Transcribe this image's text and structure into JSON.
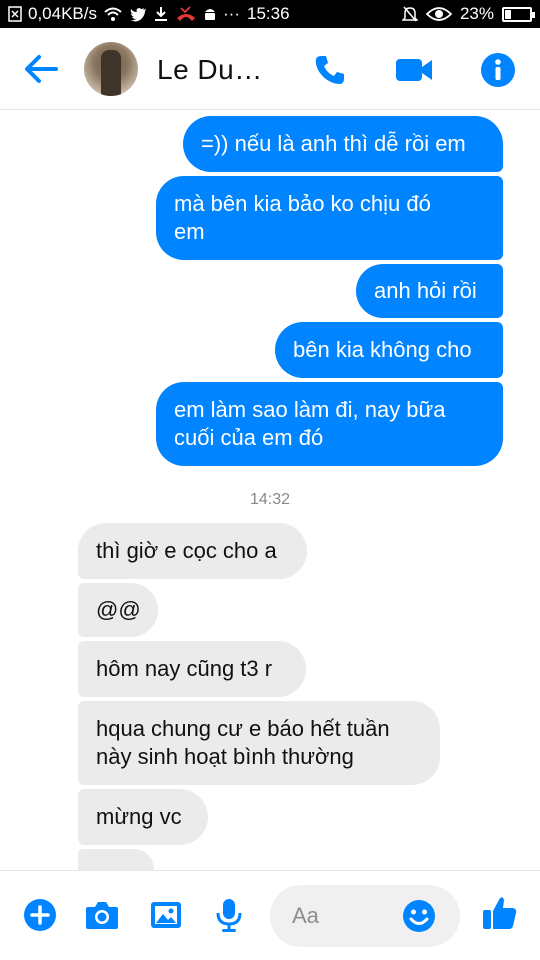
{
  "status_bar": {
    "speed": "0,04KB/s",
    "time": "15:36",
    "battery": "23%",
    "battery_level": 0.23
  },
  "header": {
    "contact_name": "Le Du…"
  },
  "messages": {
    "m1": "=)) nếu là anh thì dễ rồi em",
    "m2_line1": "mà bên kia bảo ko chịu đó",
    "m2_line2": "em",
    "m3": "anh hỏi rồi",
    "m4": "bên kia không cho",
    "m5_line1": "em làm sao làm đi, nay bữa",
    "m5_line2": "cuối của em đó",
    "timestamp": "14:32",
    "m6": "thì giờ e cọc cho a",
    "m7": "@@",
    "m8": "hôm nay cũng t3 r",
    "m9_line1": "hqua chung cư e báo hết tuần",
    "m9_line2": "này sinh hoạt bình thường",
    "m10": "mừng vc"
  },
  "composer": {
    "placeholder": "Aa"
  },
  "colors": {
    "accent": "#0084ff",
    "incoming_bubble": "#ebebeb",
    "like": "#0084ff"
  }
}
